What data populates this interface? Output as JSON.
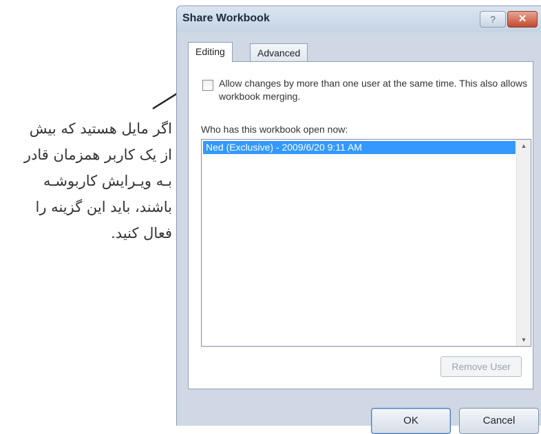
{
  "annotation": {
    "lines": [
      "اگر مایل هستید که بیش",
      "از یک کاربر همزمان قادر",
      "بـه ویـرایش کاربوشـه",
      "باشند، باید این گزینه را",
      "فعال کنید."
    ]
  },
  "dialog": {
    "title": "Share Workbook",
    "help_label": "?",
    "close_label": "✕",
    "tabs": [
      {
        "label": "Editing",
        "active": true
      },
      {
        "label": "Advanced",
        "active": false
      }
    ],
    "allow_changes": {
      "checked": false,
      "label": "Allow changes by more than one user at the same time.  This also allows workbook merging."
    },
    "who_has_open_label": "Who has this workbook open now:",
    "users": [
      "Ned (Exclusive) - 2009/6/20 9:11 AM"
    ],
    "remove_user_label": "Remove User",
    "ok_label": "OK",
    "cancel_label": "Cancel"
  }
}
